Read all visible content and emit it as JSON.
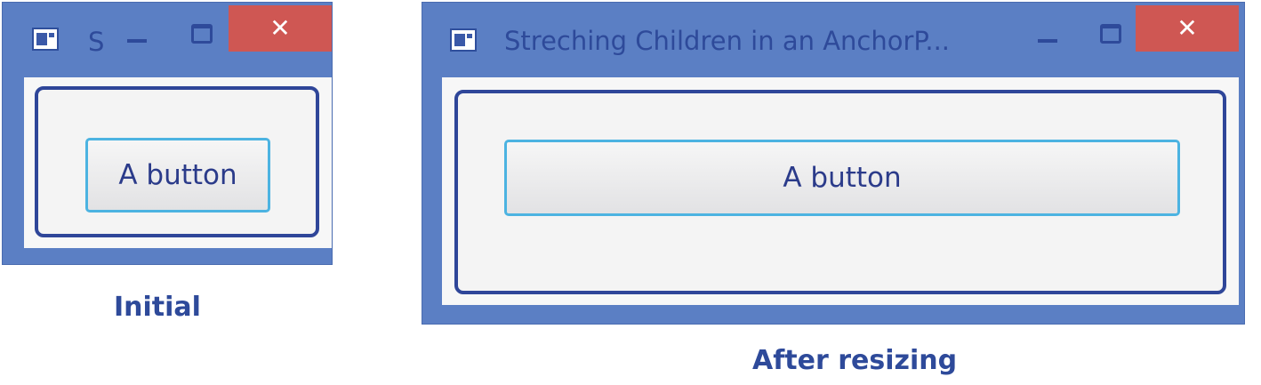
{
  "initial": {
    "window_title": "S",
    "close_glyph": "✕",
    "button_label": "A button",
    "caption": "Initial"
  },
  "resized": {
    "window_title": "Streching Children in an AnchorP...",
    "close_glyph": "✕",
    "button_label": "A button",
    "caption": "After resizing"
  },
  "icons": {
    "app": "app-window-icon",
    "minimize": "minimize-icon",
    "maximize": "maximize-icon",
    "close": "close-icon"
  },
  "colors": {
    "window_frame": "#5b7fc4",
    "title_text": "#2e4a9a",
    "close_button": "#cf5753",
    "pane_border": "#2f4699",
    "button_focus_border": "#4cb3e1"
  }
}
